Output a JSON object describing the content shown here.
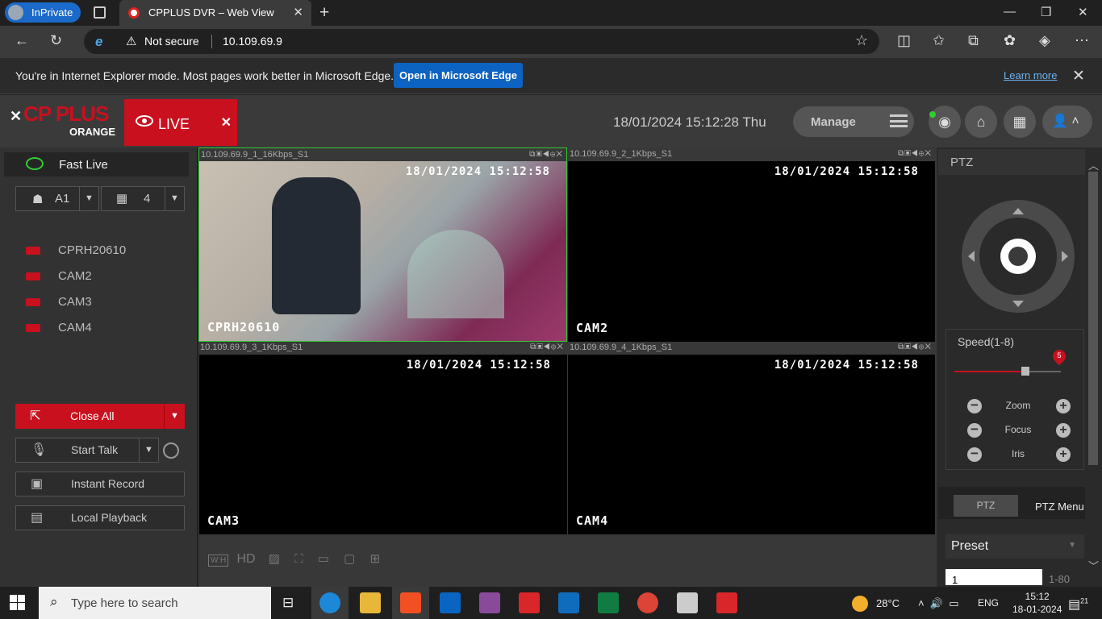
{
  "browser": {
    "inprivate": "InPrivate",
    "tab_title": "CPPLUS DVR – Web View",
    "tab_close": "✕",
    "new_tab": "+",
    "win_min": "—",
    "win_max": "❐",
    "win_close": "✕",
    "not_secure": "Not secure",
    "url": "10.109.69.9"
  },
  "ie_bar": {
    "message": "You're in Internet Explorer mode. Most pages work better in Microsoft Edge.",
    "open_button": "Open in Microsoft Edge",
    "learn_more": "Learn more",
    "close": "✕"
  },
  "header": {
    "logo": "CP PLUS",
    "logo_sub": "ORANGE",
    "live_tab": "LIVE",
    "live_close": "✕",
    "datetime": "18/01/2024 15:12:28 Thu",
    "manage": "Manage"
  },
  "left": {
    "fast_live": "Fast Live",
    "stream_select": "A1",
    "layout_select": "4",
    "cameras": [
      "CPRH20610",
      "CAM2",
      "CAM3",
      "CAM4"
    ],
    "close_all": "Close All",
    "start_talk": "Start Talk",
    "instant_record": "Instant Record",
    "local_playback": "Local Playback"
  },
  "video": {
    "channels": [
      {
        "header": "10.109.69.9_1_16Kbps_S1",
        "timestamp": "18/01/2024 15:12:58",
        "name": "CPRH20610",
        "active": true
      },
      {
        "header": "10.109.69.9_2_1Kbps_S1",
        "timestamp": "18/01/2024 15:12:58",
        "name": "CAM2",
        "active": false
      },
      {
        "header": "10.109.69.9_3_1Kbps_S1",
        "timestamp": "18/01/2024 15:12:58",
        "name": "CAM3",
        "active": false
      },
      {
        "header": "10.109.69.9_4_1Kbps_S1",
        "timestamp": "18/01/2024 15:12:58",
        "name": "CAM4",
        "active": false
      }
    ],
    "toolbar": {
      "wh": "W:H",
      "hd": "HD"
    }
  },
  "ptz": {
    "title": "PTZ",
    "speed_label": "Speed(1-8)",
    "speed_value": "5",
    "zoom": "Zoom",
    "focus": "Focus",
    "iris": "Iris",
    "tab_ptz": "PTZ",
    "tab_menu": "PTZ Menu",
    "preset": "Preset",
    "preset_value": "1",
    "preset_range": "1-80"
  },
  "taskbar": {
    "search_placeholder": "Type here to search",
    "temperature": "28°C",
    "lang": "ENG",
    "time": "15:12",
    "date": "18-01-2024",
    "notifications": "21"
  },
  "colors": {
    "accent_red": "#c8101e",
    "active_green": "#33cc33",
    "ie_blue": "#0d63c1"
  }
}
